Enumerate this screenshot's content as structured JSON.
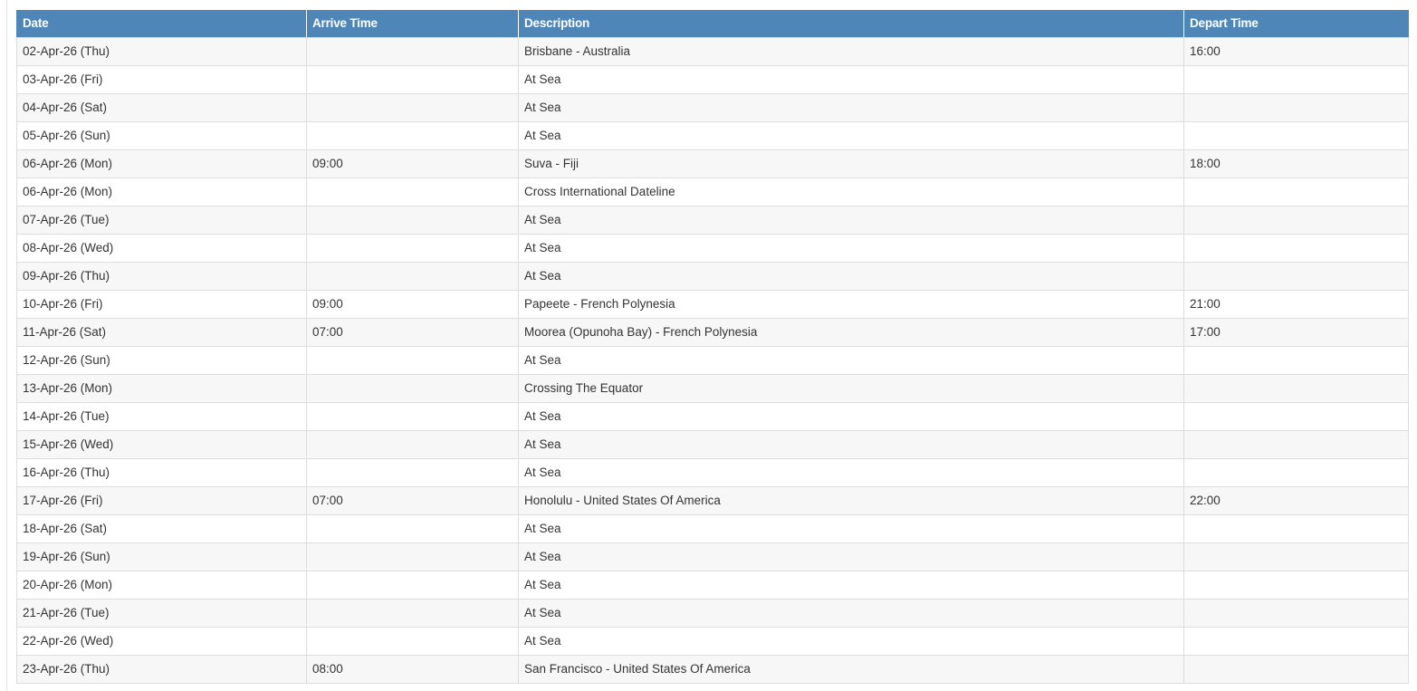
{
  "table": {
    "headers": {
      "date": "Date",
      "arrive": "Arrive Time",
      "description": "Description",
      "depart": "Depart Time"
    },
    "rows": [
      {
        "date": "02-Apr-26 (Thu)",
        "arrive": "",
        "description": "Brisbane - Australia",
        "depart": "16:00"
      },
      {
        "date": "03-Apr-26 (Fri)",
        "arrive": "",
        "description": "At Sea",
        "depart": ""
      },
      {
        "date": "04-Apr-26 (Sat)",
        "arrive": "",
        "description": "At Sea",
        "depart": ""
      },
      {
        "date": "05-Apr-26 (Sun)",
        "arrive": "",
        "description": "At Sea",
        "depart": ""
      },
      {
        "date": "06-Apr-26 (Mon)",
        "arrive": "09:00",
        "description": "Suva - Fiji",
        "depart": "18:00"
      },
      {
        "date": "06-Apr-26 (Mon)",
        "arrive": "",
        "description": "Cross International Dateline",
        "depart": ""
      },
      {
        "date": "07-Apr-26 (Tue)",
        "arrive": "",
        "description": "At Sea",
        "depart": ""
      },
      {
        "date": "08-Apr-26 (Wed)",
        "arrive": "",
        "description": "At Sea",
        "depart": ""
      },
      {
        "date": "09-Apr-26 (Thu)",
        "arrive": "",
        "description": "At Sea",
        "depart": ""
      },
      {
        "date": "10-Apr-26 (Fri)",
        "arrive": "09:00",
        "description": "Papeete - French Polynesia",
        "depart": "21:00"
      },
      {
        "date": "11-Apr-26 (Sat)",
        "arrive": "07:00",
        "description": "Moorea (Opunoha Bay) - French Polynesia",
        "depart": "17:00"
      },
      {
        "date": "12-Apr-26 (Sun)",
        "arrive": "",
        "description": "At Sea",
        "depart": ""
      },
      {
        "date": "13-Apr-26 (Mon)",
        "arrive": "",
        "description": "Crossing The Equator",
        "depart": ""
      },
      {
        "date": "14-Apr-26 (Tue)",
        "arrive": "",
        "description": "At Sea",
        "depart": ""
      },
      {
        "date": "15-Apr-26 (Wed)",
        "arrive": "",
        "description": "At Sea",
        "depart": ""
      },
      {
        "date": "16-Apr-26 (Thu)",
        "arrive": "",
        "description": "At Sea",
        "depart": ""
      },
      {
        "date": "17-Apr-26 (Fri)",
        "arrive": "07:00",
        "description": "Honolulu - United States Of America",
        "depart": "22:00"
      },
      {
        "date": "18-Apr-26 (Sat)",
        "arrive": "",
        "description": "At Sea",
        "depart": ""
      },
      {
        "date": "19-Apr-26 (Sun)",
        "arrive": "",
        "description": "At Sea",
        "depart": ""
      },
      {
        "date": "20-Apr-26 (Mon)",
        "arrive": "",
        "description": "At Sea",
        "depart": ""
      },
      {
        "date": "21-Apr-26 (Tue)",
        "arrive": "",
        "description": "At Sea",
        "depart": ""
      },
      {
        "date": "22-Apr-26 (Wed)",
        "arrive": "",
        "description": "At Sea",
        "depart": ""
      },
      {
        "date": "23-Apr-26 (Thu)",
        "arrive": "08:00",
        "description": "San Francisco - United States Of America",
        "depart": ""
      }
    ]
  },
  "colors": {
    "header_background": "#4f86b8",
    "header_text": "#ffffff",
    "row_stripe": "#f7f7f7",
    "border": "#dddddd"
  }
}
